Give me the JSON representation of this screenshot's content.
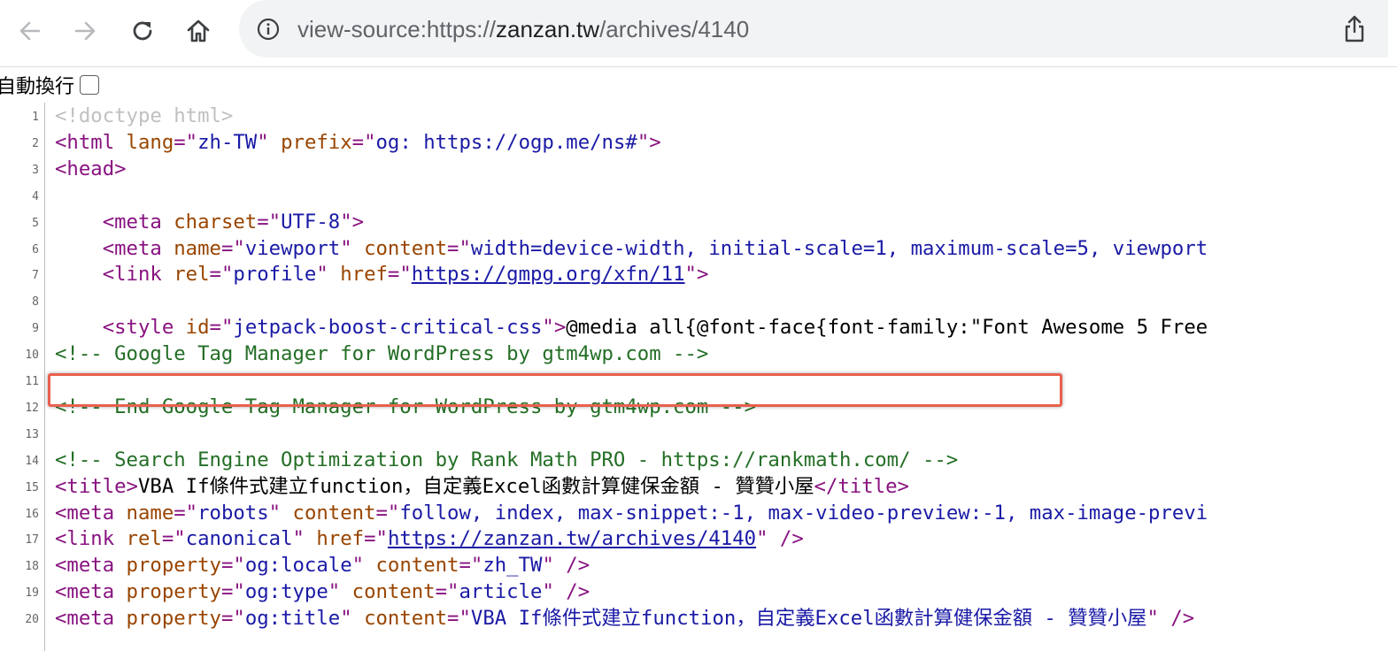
{
  "toolbar": {
    "back_icon": "arrow-left-icon",
    "forward_icon": "arrow-right-icon",
    "reload_icon": "reload-icon",
    "home_icon": "home-icon",
    "url_prefix": "view-source:https://",
    "url_domain": "zanzan.tw",
    "url_path": "/archives/4140",
    "share_icon": "share-icon"
  },
  "wrap": {
    "label": "自動換行"
  },
  "lines": [
    {
      "n": "1",
      "parts": [
        {
          "c": "doctype",
          "t": "<!doctype html>"
        }
      ]
    },
    {
      "n": "2",
      "parts": [
        {
          "c": "tag",
          "t": "<html "
        },
        {
          "c": "attr",
          "t": "lang"
        },
        {
          "c": "tag",
          "t": "=\""
        },
        {
          "c": "val",
          "t": "zh-TW"
        },
        {
          "c": "tag",
          "t": "\" "
        },
        {
          "c": "attr",
          "t": "prefix"
        },
        {
          "c": "tag",
          "t": "=\""
        },
        {
          "c": "val",
          "t": "og: https://ogp.me/ns#"
        },
        {
          "c": "tag",
          "t": "\">"
        }
      ]
    },
    {
      "n": "3",
      "parts": [
        {
          "c": "tag",
          "t": "<head>"
        }
      ]
    },
    {
      "n": "4",
      "parts": []
    },
    {
      "n": "5",
      "parts": [
        {
          "c": "txt",
          "t": "    "
        },
        {
          "c": "tag",
          "t": "<meta "
        },
        {
          "c": "attr",
          "t": "charset"
        },
        {
          "c": "tag",
          "t": "=\""
        },
        {
          "c": "val",
          "t": "UTF-8"
        },
        {
          "c": "tag",
          "t": "\">"
        }
      ]
    },
    {
      "n": "6",
      "parts": [
        {
          "c": "txt",
          "t": "    "
        },
        {
          "c": "tag",
          "t": "<meta "
        },
        {
          "c": "attr",
          "t": "name"
        },
        {
          "c": "tag",
          "t": "=\""
        },
        {
          "c": "val",
          "t": "viewport"
        },
        {
          "c": "tag",
          "t": "\" "
        },
        {
          "c": "attr",
          "t": "content"
        },
        {
          "c": "tag",
          "t": "=\""
        },
        {
          "c": "val",
          "t": "width=device-width, initial-scale=1, maximum-scale=5, viewport"
        }
      ]
    },
    {
      "n": "7",
      "parts": [
        {
          "c": "txt",
          "t": "    "
        },
        {
          "c": "tag",
          "t": "<link "
        },
        {
          "c": "attr",
          "t": "rel"
        },
        {
          "c": "tag",
          "t": "=\""
        },
        {
          "c": "val",
          "t": "profile"
        },
        {
          "c": "tag",
          "t": "\" "
        },
        {
          "c": "attr",
          "t": "href"
        },
        {
          "c": "tag",
          "t": "=\""
        },
        {
          "c": "link",
          "t": "https://gmpg.org/xfn/11"
        },
        {
          "c": "tag",
          "t": "\">"
        }
      ]
    },
    {
      "n": "8",
      "parts": []
    },
    {
      "n": "9",
      "parts": [
        {
          "c": "txt",
          "t": "    "
        },
        {
          "c": "tag",
          "t": "<style "
        },
        {
          "c": "attr",
          "t": "id"
        },
        {
          "c": "tag",
          "t": "=\""
        },
        {
          "c": "val",
          "t": "jetpack-boost-critical-css"
        },
        {
          "c": "tag",
          "t": "\">"
        },
        {
          "c": "txt",
          "t": "@media all{@font-face{font-family:\"Font Awesome 5 Free"
        }
      ]
    },
    {
      "n": "10",
      "parts": [
        {
          "c": "comment",
          "t": "<!-- Google Tag Manager for WordPress by gtm4wp.com -->"
        }
      ]
    },
    {
      "n": "11",
      "parts": []
    },
    {
      "n": "12",
      "parts": [
        {
          "c": "comment",
          "t": "<!-- End Google Tag Manager for WordPress by gtm4wp.com -->"
        }
      ]
    },
    {
      "n": "13",
      "parts": []
    },
    {
      "n": "14",
      "parts": [
        {
          "c": "comment",
          "t": "<!-- Search Engine Optimization by Rank Math PRO - https://rankmath.com/ -->"
        }
      ]
    },
    {
      "n": "15",
      "parts": [
        {
          "c": "tag",
          "t": "<title>"
        },
        {
          "c": "txt",
          "t": "VBA If條件式建立function，自定義Excel函數計算健保金額 - 贊贊小屋"
        },
        {
          "c": "tag",
          "t": "</title>"
        }
      ]
    },
    {
      "n": "16",
      "parts": [
        {
          "c": "tag",
          "t": "<meta "
        },
        {
          "c": "attr",
          "t": "name"
        },
        {
          "c": "tag",
          "t": "=\""
        },
        {
          "c": "val",
          "t": "robots"
        },
        {
          "c": "tag",
          "t": "\" "
        },
        {
          "c": "attr",
          "t": "content"
        },
        {
          "c": "tag",
          "t": "=\""
        },
        {
          "c": "val",
          "t": "follow, index, max-snippet:-1, max-video-preview:-1, max-image-previ"
        }
      ]
    },
    {
      "n": "17",
      "parts": [
        {
          "c": "tag",
          "t": "<link "
        },
        {
          "c": "attr",
          "t": "rel"
        },
        {
          "c": "tag",
          "t": "=\""
        },
        {
          "c": "val",
          "t": "canonical"
        },
        {
          "c": "tag",
          "t": "\" "
        },
        {
          "c": "attr",
          "t": "href"
        },
        {
          "c": "tag",
          "t": "=\""
        },
        {
          "c": "link",
          "t": "https://zanzan.tw/archives/4140"
        },
        {
          "c": "tag",
          "t": "\" />"
        }
      ]
    },
    {
      "n": "18",
      "parts": [
        {
          "c": "tag",
          "t": "<meta "
        },
        {
          "c": "attr",
          "t": "property"
        },
        {
          "c": "tag",
          "t": "=\""
        },
        {
          "c": "val",
          "t": "og:locale"
        },
        {
          "c": "tag",
          "t": "\" "
        },
        {
          "c": "attr",
          "t": "content"
        },
        {
          "c": "tag",
          "t": "=\""
        },
        {
          "c": "val",
          "t": "zh_TW"
        },
        {
          "c": "tag",
          "t": "\" />"
        }
      ]
    },
    {
      "n": "19",
      "parts": [
        {
          "c": "tag",
          "t": "<meta "
        },
        {
          "c": "attr",
          "t": "property"
        },
        {
          "c": "tag",
          "t": "=\""
        },
        {
          "c": "val",
          "t": "og:type"
        },
        {
          "c": "tag",
          "t": "\" "
        },
        {
          "c": "attr",
          "t": "content"
        },
        {
          "c": "tag",
          "t": "=\""
        },
        {
          "c": "val",
          "t": "article"
        },
        {
          "c": "tag",
          "t": "\" />"
        }
      ]
    },
    {
      "n": "20",
      "parts": [
        {
          "c": "tag",
          "t": "<meta "
        },
        {
          "c": "attr",
          "t": "property"
        },
        {
          "c": "tag",
          "t": "=\""
        },
        {
          "c": "val",
          "t": "og:title"
        },
        {
          "c": "tag",
          "t": "\" "
        },
        {
          "c": "attr",
          "t": "content"
        },
        {
          "c": "tag",
          "t": "=\""
        },
        {
          "c": "val",
          "t": "VBA If條件式建立function，自定義Excel函數計算健保金額 - 贊贊小屋"
        },
        {
          "c": "tag",
          "t": "\" />"
        }
      ]
    }
  ]
}
